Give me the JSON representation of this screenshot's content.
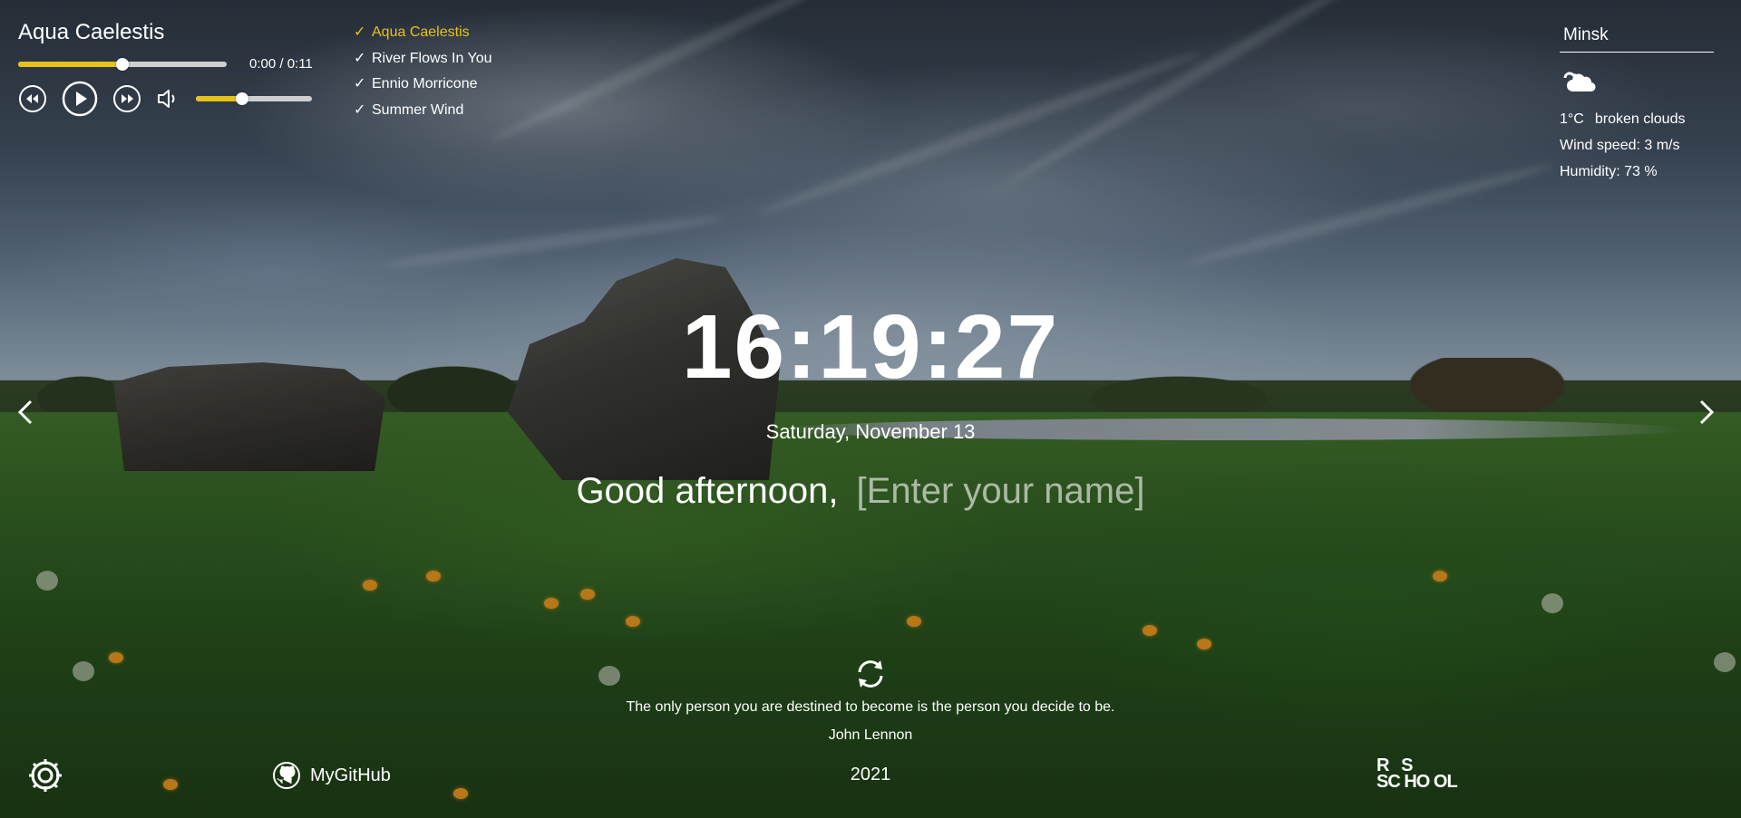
{
  "player": {
    "title": "Aqua Caelestis",
    "time": "0:00 / 0:11",
    "progress_fraction": 0.5,
    "volume_fraction": 0.4,
    "icons": [
      "rewind-icon",
      "play-icon",
      "forward-icon",
      "volume-icon"
    ],
    "accent": "#e6c219"
  },
  "playlist": [
    {
      "check": "✓",
      "name": "Aqua Caelestis",
      "active": true
    },
    {
      "check": "✓",
      "name": "River Flows In You",
      "active": false
    },
    {
      "check": "✓",
      "name": "Ennio Morricone",
      "active": false
    },
    {
      "check": "✓",
      "name": "Summer Wind",
      "active": false
    }
  ],
  "weather": {
    "city": "Minsk",
    "icon": "broken-clouds-icon",
    "temperature": "1°C",
    "description": "broken clouds",
    "wind": "Wind speed: 3 m/s",
    "humidity": "Humidity: 73 %"
  },
  "clock": {
    "time": "16:19:27"
  },
  "date": "Saturday, November 13",
  "greeting": {
    "text": "Good afternoon,",
    "placeholder": "[Enter your name]"
  },
  "quote": {
    "text": "The only person you are destined to become is the person you decide to be.",
    "author": "John Lennon"
  },
  "footer": {
    "github_label": "MyGitHub",
    "year": "2021",
    "rss_line1": "R   S",
    "rss_line2": "SC HO OL"
  }
}
